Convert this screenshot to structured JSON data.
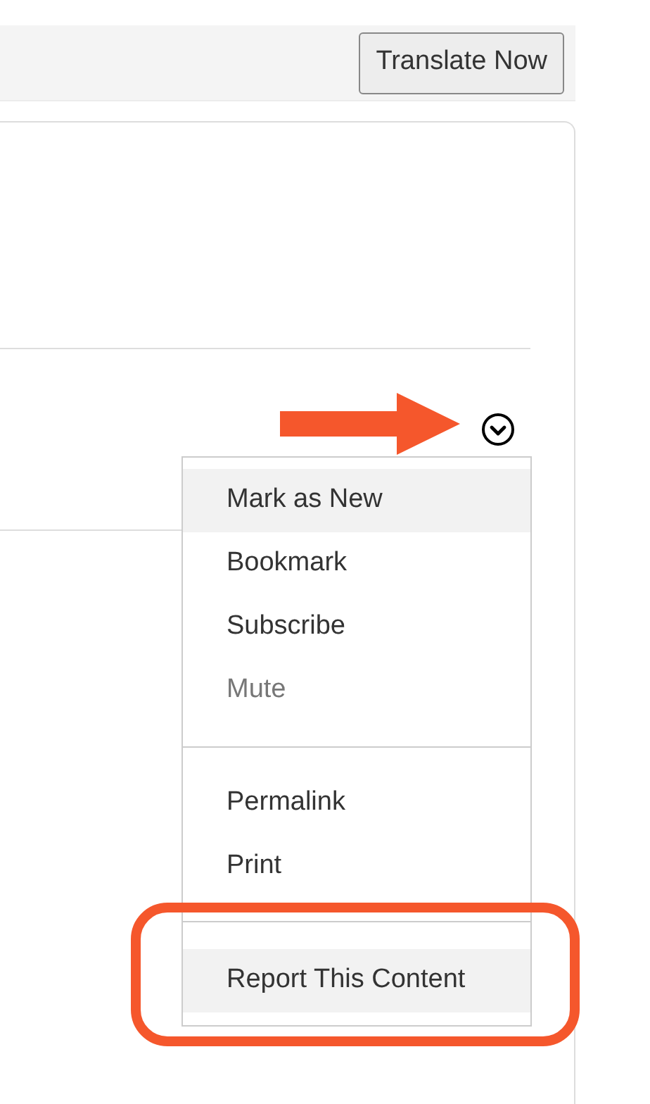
{
  "toolbar": {
    "button": "Translate Now"
  },
  "menu": {
    "sections": [
      {
        "items": [
          {
            "label": "Mark as New",
            "selected": true,
            "disabled": false
          },
          {
            "label": "Bookmark",
            "selected": false,
            "disabled": false
          },
          {
            "label": "Subscribe",
            "selected": false,
            "disabled": false
          },
          {
            "label": "Mute",
            "selected": false,
            "disabled": true
          }
        ]
      },
      {
        "items": [
          {
            "label": "Permalink",
            "selected": false,
            "disabled": false
          },
          {
            "label": "Print",
            "selected": false,
            "disabled": false
          }
        ]
      },
      {
        "items": [
          {
            "label": "Report This Content",
            "selected": true,
            "disabled": false
          }
        ]
      }
    ]
  }
}
